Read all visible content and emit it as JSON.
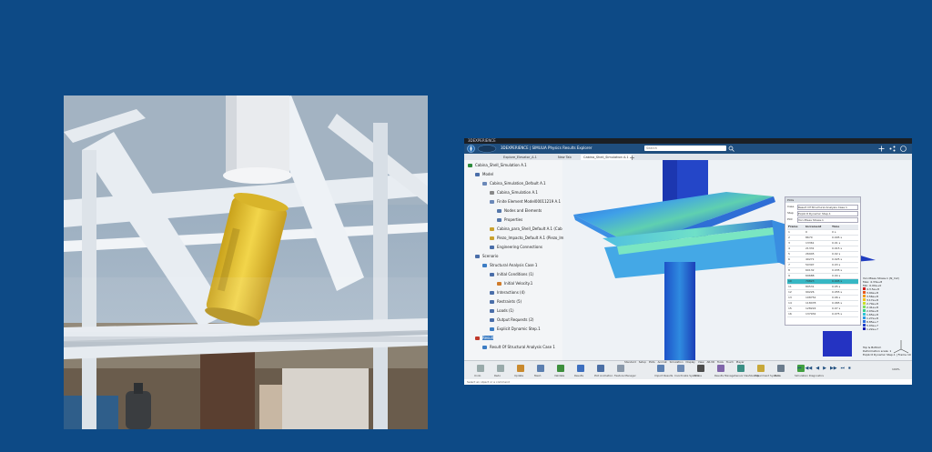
{
  "window": {
    "title_bar": "3DEXPERIENCE",
    "brand": "3DEXPERIENCE | SIMULIA Physics Results Explorer",
    "search_placeholder": "Search",
    "tabs": [
      "Explore_Elevator_A.1",
      "New Tab",
      "Cabina_Shell_Simulation A.1"
    ]
  },
  "tree": [
    {
      "label": "Cabina_Shell_Simulation A.1",
      "indent": 0,
      "color": "#2e8b3d"
    },
    {
      "label": "Model",
      "indent": 1,
      "color": "#4a6ea9"
    },
    {
      "label": "Cabina_Simulation_Default A.1",
      "indent": 2,
      "color": "#6a88b8"
    },
    {
      "label": "Cabina_Simulation A.1",
      "indent": 3,
      "color": "#888"
    },
    {
      "label": "Finite Element Model00011219 A.1",
      "indent": 3,
      "color": "#6a88b8"
    },
    {
      "label": "Nodes and Elements",
      "indent": 4,
      "color": "#5577aa"
    },
    {
      "label": "Properties",
      "indent": 4,
      "color": "#5577aa"
    },
    {
      "label": "Cabina_para_Shell_Default A.1 (Cab",
      "indent": 3,
      "color": "#c9a12d"
    },
    {
      "label": "Piezo_Impacto_Default A.1 (Piezo_Im",
      "indent": 3,
      "color": "#c9a12d"
    },
    {
      "label": "Engineering Connections",
      "indent": 3,
      "color": "#4a6ea9"
    },
    {
      "label": "Scenario",
      "indent": 1,
      "color": "#4a6ea9"
    },
    {
      "label": "Structural Analysis Case 1",
      "indent": 2,
      "color": "#3c7dc4"
    },
    {
      "label": "Initial Conditions (1)",
      "indent": 3,
      "color": "#4a6ea9"
    },
    {
      "label": "Initial Velocity.1",
      "indent": 4,
      "color": "#d07b2a"
    },
    {
      "label": "Interactions (4)",
      "indent": 3,
      "color": "#4a6ea9"
    },
    {
      "label": "Restraints (5)",
      "indent": 3,
      "color": "#4a6ea9"
    },
    {
      "label": "Loads (1)",
      "indent": 3,
      "color": "#4a6ea9"
    },
    {
      "label": "Output Requests (2)",
      "indent": 3,
      "color": "#4a6ea9"
    },
    {
      "label": "Explicit Dynamic Step.1",
      "indent": 3,
      "color": "#3c7dc4"
    },
    {
      "label": "Result",
      "indent": 1,
      "color": "#c0392b"
    },
    {
      "label": "Result Of Structural Analysis Case 1",
      "indent": 2,
      "color": "#3c7dc4"
    }
  ],
  "results_panel": {
    "header": "Plots",
    "field_rows": [
      {
        "label": "Case",
        "value": "Result Of Structural Analysis Case 1"
      },
      {
        "label": "Step",
        "value": "Explicit Dynamic Step.1"
      },
      {
        "label": "Plot",
        "value": "Von Mises Stress.1"
      }
    ],
    "columns": [
      "Frame",
      "Increment",
      "Time"
    ],
    "rows": [
      [
        "1",
        "0",
        "0 s"
      ],
      [
        "2",
        "8670",
        "0.005 s"
      ],
      [
        "3",
        "13361",
        "0.01 s"
      ],
      [
        "4",
        "21331",
        "0.015 s"
      ],
      [
        "5",
        "26945",
        "0.02 s"
      ],
      [
        "6",
        "40271",
        "0.025 s"
      ],
      [
        "7",
        "50397",
        "0.03 s"
      ],
      [
        "8",
        "60132",
        "0.035 s"
      ],
      [
        "9",
        "69688",
        "0.04 s"
      ],
      [
        "10",
        "79823",
        "0.045 s"
      ],
      [
        "11",
        "89531",
        "0.05 s"
      ],
      [
        "12",
        "99226",
        "0.055 s"
      ],
      [
        "13",
        "108752",
        "0.06 s"
      ],
      [
        "14",
        "118478",
        "0.065 s"
      ],
      [
        "15",
        "128224",
        "0.07 s"
      ],
      [
        "16",
        "137932",
        "0.075 s"
      ]
    ],
    "selected_row": 9
  },
  "legend": {
    "title": "Von Mises Stress.1 (N_m2)",
    "values": [
      "4.3.5e+8",
      "3.94e+8",
      "3.56e+8",
      "3.17e+8",
      "2.79e+8",
      "2.41e+8",
      "2.03e+8",
      "1.65e+8",
      "1.27e+8",
      "8.85e+7",
      "5.03e+7",
      "1.22e+7"
    ],
    "max": "Max: 4.33e+8",
    "min": "Min: 0.00e+0"
  },
  "viewinfo": [
    "Top & Bottom",
    "Deformation scale: 1",
    "Explicit Dynamic Step.1 | Frame 10"
  ],
  "toolbar": {
    "groups": [
      {
        "label": "Undo",
        "color": "#9aa"
      },
      {
        "label": "Redo",
        "color": "#9aa"
      },
      {
        "label": "Update",
        "color": "#c98a2e"
      },
      {
        "label": "Mesh",
        "color": "#5b7fb0"
      },
      {
        "label": "Validate",
        "color": "#3d8f3d"
      },
      {
        "label": "Results",
        "color": "#3d6fbf"
      },
      {
        "label": "Plot Animation",
        "color": "#4b6fa5"
      },
      {
        "label": "Feature Manager",
        "color": "#8a99aa"
      },
      {
        "label": "Import Results",
        "color": "#5a7fb2"
      },
      {
        "label": "Coordinate System",
        "color": "#6c8ab4"
      },
      {
        "label": "Probe",
        "color": "#4d4d4d"
      },
      {
        "label": "Results Manage",
        "color": "#8066aa"
      },
      {
        "label": "Sensor Dashboards",
        "color": "#3b8f85"
      },
      {
        "label": "Experiment System",
        "color": "#c7a83a"
      },
      {
        "label": "Tools",
        "color": "#6b7c8d"
      },
      {
        "label": "Simulation Diagnostics",
        "color": "#41a041"
      }
    ],
    "tabs": [
      "Standard",
      "Setup",
      "Plots",
      "Animat",
      "Simulation",
      "Display",
      "View",
      "AR-VR",
      "Tools",
      "Touch",
      "Player"
    ],
    "player_zoom": "100%"
  },
  "status_bar": "Select an object or a command",
  "colors": {
    "background": "#0d4a86",
    "topbar": "#1f4e7e",
    "highlight_row": "#37b7c4"
  }
}
